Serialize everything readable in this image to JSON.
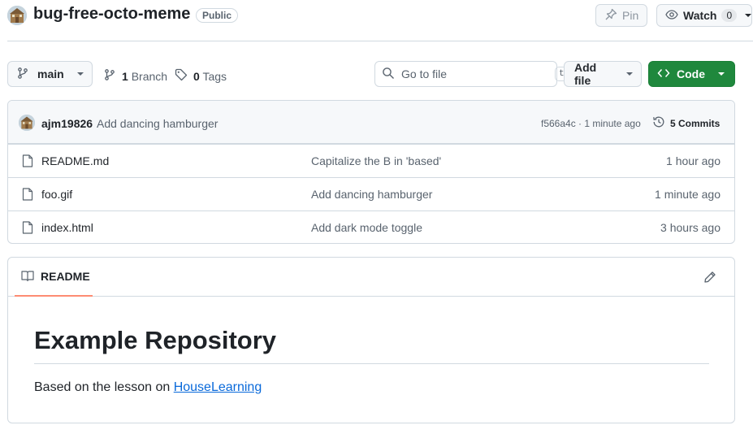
{
  "repo": {
    "name": "bug-free-octo-meme",
    "visibility": "Public",
    "pin_label": "Pin",
    "watch_label": "Watch",
    "watch_count": "0"
  },
  "toolbar": {
    "branch_name": "main",
    "branch_count": "1",
    "branch_label": "Branch",
    "tag_count": "0",
    "tag_label": "Tags",
    "search_placeholder": "Go to file",
    "search_shortcut": "t",
    "add_file_label": "Add file",
    "code_label": "Code"
  },
  "latest_commit": {
    "author": "ajm19826",
    "message": "Add dancing hamburger",
    "meta": "f566a4c · 1 minute ago",
    "commit_count_label": "5 Commits"
  },
  "files": [
    {
      "name": "README.md",
      "message": "Capitalize the B in 'based'",
      "time": "1 hour ago"
    },
    {
      "name": "foo.gif",
      "message": "Add dancing hamburger",
      "time": "1 minute ago"
    },
    {
      "name": "index.html",
      "message": "Add dark mode toggle",
      "time": "3 hours ago"
    }
  ],
  "readme": {
    "tab_label": "README",
    "heading": "Example Repository",
    "text": "Based on the lesson on ",
    "link_text": "HouseLearning"
  },
  "colors": {
    "accent_green": "#1f883d",
    "link_blue": "#0969da",
    "tab_underline": "#fd8c73"
  }
}
